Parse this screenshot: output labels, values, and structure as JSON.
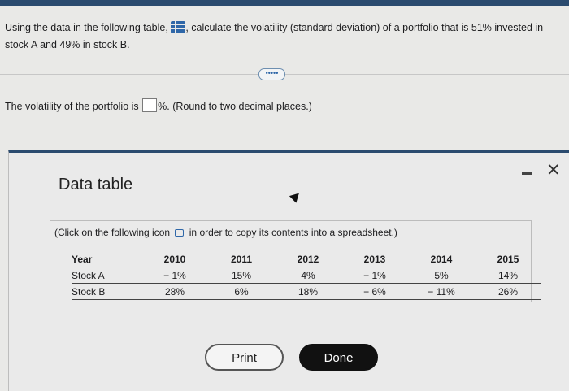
{
  "question": {
    "text_before_icon": "Using the data in the following table,",
    "text_after_icon": ", calculate the volatility (standard deviation) of a portfolio that is 51% invested in stock A and 49% in stock B.",
    "table_icon": "table-grid-icon"
  },
  "expand_button_label": "•••••",
  "answer": {
    "prefix": "The volatility of the portfolio is",
    "input_value": "",
    "suffix": "%. (Round to two decimal places.)"
  },
  "dialog": {
    "title": "Data table",
    "minimize_icon": "minimize-icon",
    "close_label": "✕",
    "instruction_before": "(Click on the following icon",
    "copy_icon": "copy-icon",
    "instruction_after": "in order to copy its contents into a spreadsheet.)",
    "table": {
      "headers": [
        "Year",
        "2010",
        "2011",
        "2012",
        "2013",
        "2014",
        "2015"
      ],
      "rows": [
        [
          "Stock A",
          "− 1%",
          "15%",
          "4%",
          "− 1%",
          "5%",
          "14%"
        ],
        [
          "Stock B",
          "28%",
          "6%",
          "18%",
          "− 6%",
          "− 11%",
          "26%"
        ]
      ]
    },
    "print_label": "Print",
    "done_label": "Done"
  },
  "colors": {
    "accent": "#2f67a8",
    "header_bar": "#2b4b6f",
    "done_button": "#111111"
  }
}
